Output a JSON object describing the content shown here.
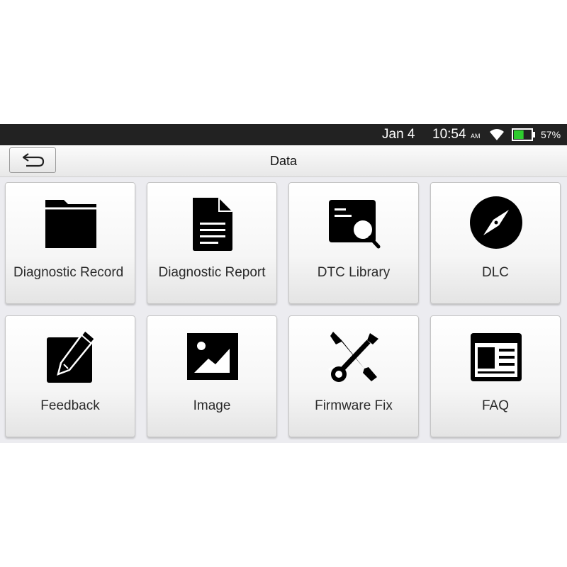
{
  "status_bar": {
    "date": "Jan 4",
    "time": "10:54",
    "ampm": "AM",
    "battery_percent": "57%",
    "battery_level": 0.57,
    "battery_color": "#2ecc2e",
    "wifi_icon": "wifi-icon"
  },
  "header": {
    "title": "Data",
    "back_icon": "back-arrow-icon"
  },
  "tiles": [
    {
      "label": "Diagnostic Record",
      "icon": "folder-icon"
    },
    {
      "label": "Diagnostic Report",
      "icon": "document-icon"
    },
    {
      "label": "DTC Library",
      "icon": "magnifier-document-icon"
    },
    {
      "label": "DLC",
      "icon": "compass-icon"
    },
    {
      "label": "Feedback",
      "icon": "pencil-icon"
    },
    {
      "label": "Image",
      "icon": "image-icon"
    },
    {
      "label": "Firmware Fix",
      "icon": "tools-icon"
    },
    {
      "label": "FAQ",
      "icon": "newspaper-icon"
    }
  ]
}
